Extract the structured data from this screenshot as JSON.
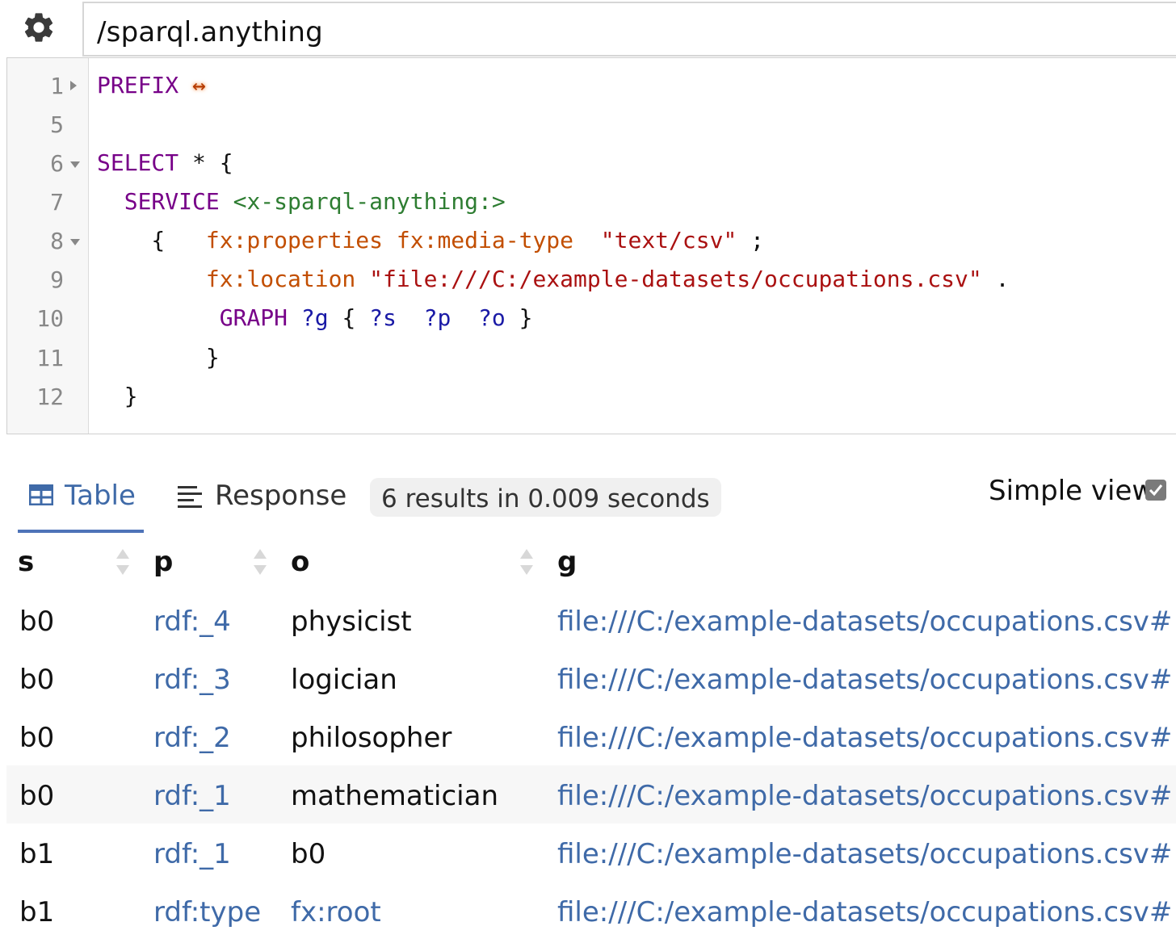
{
  "endpoint": {
    "value": "/sparql.anything"
  },
  "editor": {
    "lines": [
      {
        "num": "1",
        "fold": "right",
        "parts": [
          {
            "t": "PREFIX",
            "c": "kw"
          },
          {
            "t": " ",
            "c": ""
          },
          {
            "t": "↔",
            "c": "arrow"
          }
        ]
      },
      {
        "num": "5",
        "fold": "",
        "parts": []
      },
      {
        "num": "6",
        "fold": "down",
        "parts": [
          {
            "t": "SELECT",
            "c": "kw"
          },
          {
            "t": " * {",
            "c": ""
          }
        ]
      },
      {
        "num": "7",
        "fold": "",
        "parts": [
          {
            "t": "  ",
            "c": ""
          },
          {
            "t": "SERVICE",
            "c": "kw"
          },
          {
            "t": " ",
            "c": ""
          },
          {
            "t": "<x-sparql-anything:>",
            "c": "iri"
          }
        ]
      },
      {
        "num": "8",
        "fold": "down",
        "parts": [
          {
            "t": "    {   ",
            "c": ""
          },
          {
            "t": "fx:properties",
            "c": "pf"
          },
          {
            "t": " ",
            "c": ""
          },
          {
            "t": "fx:media-type",
            "c": "pf"
          },
          {
            "t": "  ",
            "c": ""
          },
          {
            "t": "\"text/csv\"",
            "c": "str"
          },
          {
            "t": " ;",
            "c": ""
          }
        ]
      },
      {
        "num": "9",
        "fold": "",
        "parts": [
          {
            "t": "        ",
            "c": ""
          },
          {
            "t": "fx:location",
            "c": "pf"
          },
          {
            "t": " ",
            "c": ""
          },
          {
            "t": "\"file:///C:/example-datasets/occupations.csv\"",
            "c": "str"
          },
          {
            "t": " .",
            "c": ""
          }
        ]
      },
      {
        "num": "10",
        "fold": "",
        "parts": [
          {
            "t": "         ",
            "c": ""
          },
          {
            "t": "GRAPH",
            "c": "kw"
          },
          {
            "t": " ",
            "c": ""
          },
          {
            "t": "?g",
            "c": "var"
          },
          {
            "t": " { ",
            "c": ""
          },
          {
            "t": "?s",
            "c": "var"
          },
          {
            "t": "  ",
            "c": ""
          },
          {
            "t": "?p",
            "c": "var"
          },
          {
            "t": "  ",
            "c": ""
          },
          {
            "t": "?o",
            "c": "var"
          },
          {
            "t": " }",
            "c": ""
          }
        ]
      },
      {
        "num": "11",
        "fold": "",
        "parts": [
          {
            "t": "        }",
            "c": ""
          }
        ]
      },
      {
        "num": "12",
        "fold": "",
        "parts": [
          {
            "t": "  }",
            "c": ""
          }
        ]
      }
    ]
  },
  "results": {
    "tabs": {
      "table": "Table",
      "response": "Response"
    },
    "summary": "6 results in 0.009 seconds",
    "simple_view_label": "Simple view",
    "simple_view_checked": true,
    "columns": [
      "s",
      "p",
      "o",
      "g"
    ],
    "rows": [
      {
        "s": "b0",
        "p": "rdf:_4",
        "o": "physicist",
        "g": "file:///C:/example-datasets/occupations.csv#"
      },
      {
        "s": "b0",
        "p": "rdf:_3",
        "o": "logician",
        "g": "file:///C:/example-datasets/occupations.csv#"
      },
      {
        "s": "b0",
        "p": "rdf:_2",
        "o": "philosopher",
        "g": "file:///C:/example-datasets/occupations.csv#"
      },
      {
        "s": "b0",
        "p": "rdf:_1",
        "o": "mathematician",
        "g": "file:///C:/example-datasets/occupations.csv#"
      },
      {
        "s": "b1",
        "p": "rdf:_1",
        "o": "b0",
        "g": "file:///C:/example-datasets/occupations.csv#"
      },
      {
        "s": "b1",
        "p": "rdf:type",
        "o": "fx:root",
        "o_link": true,
        "g": "file:///C:/example-datasets/occupations.csv#"
      }
    ]
  },
  "colors": {
    "accent": "#3f6aa8",
    "keyword": "#770088",
    "prefixed": "#c24e00",
    "iri": "#2e7d32",
    "string": "#aa1111",
    "variable": "#1a1aa6"
  }
}
